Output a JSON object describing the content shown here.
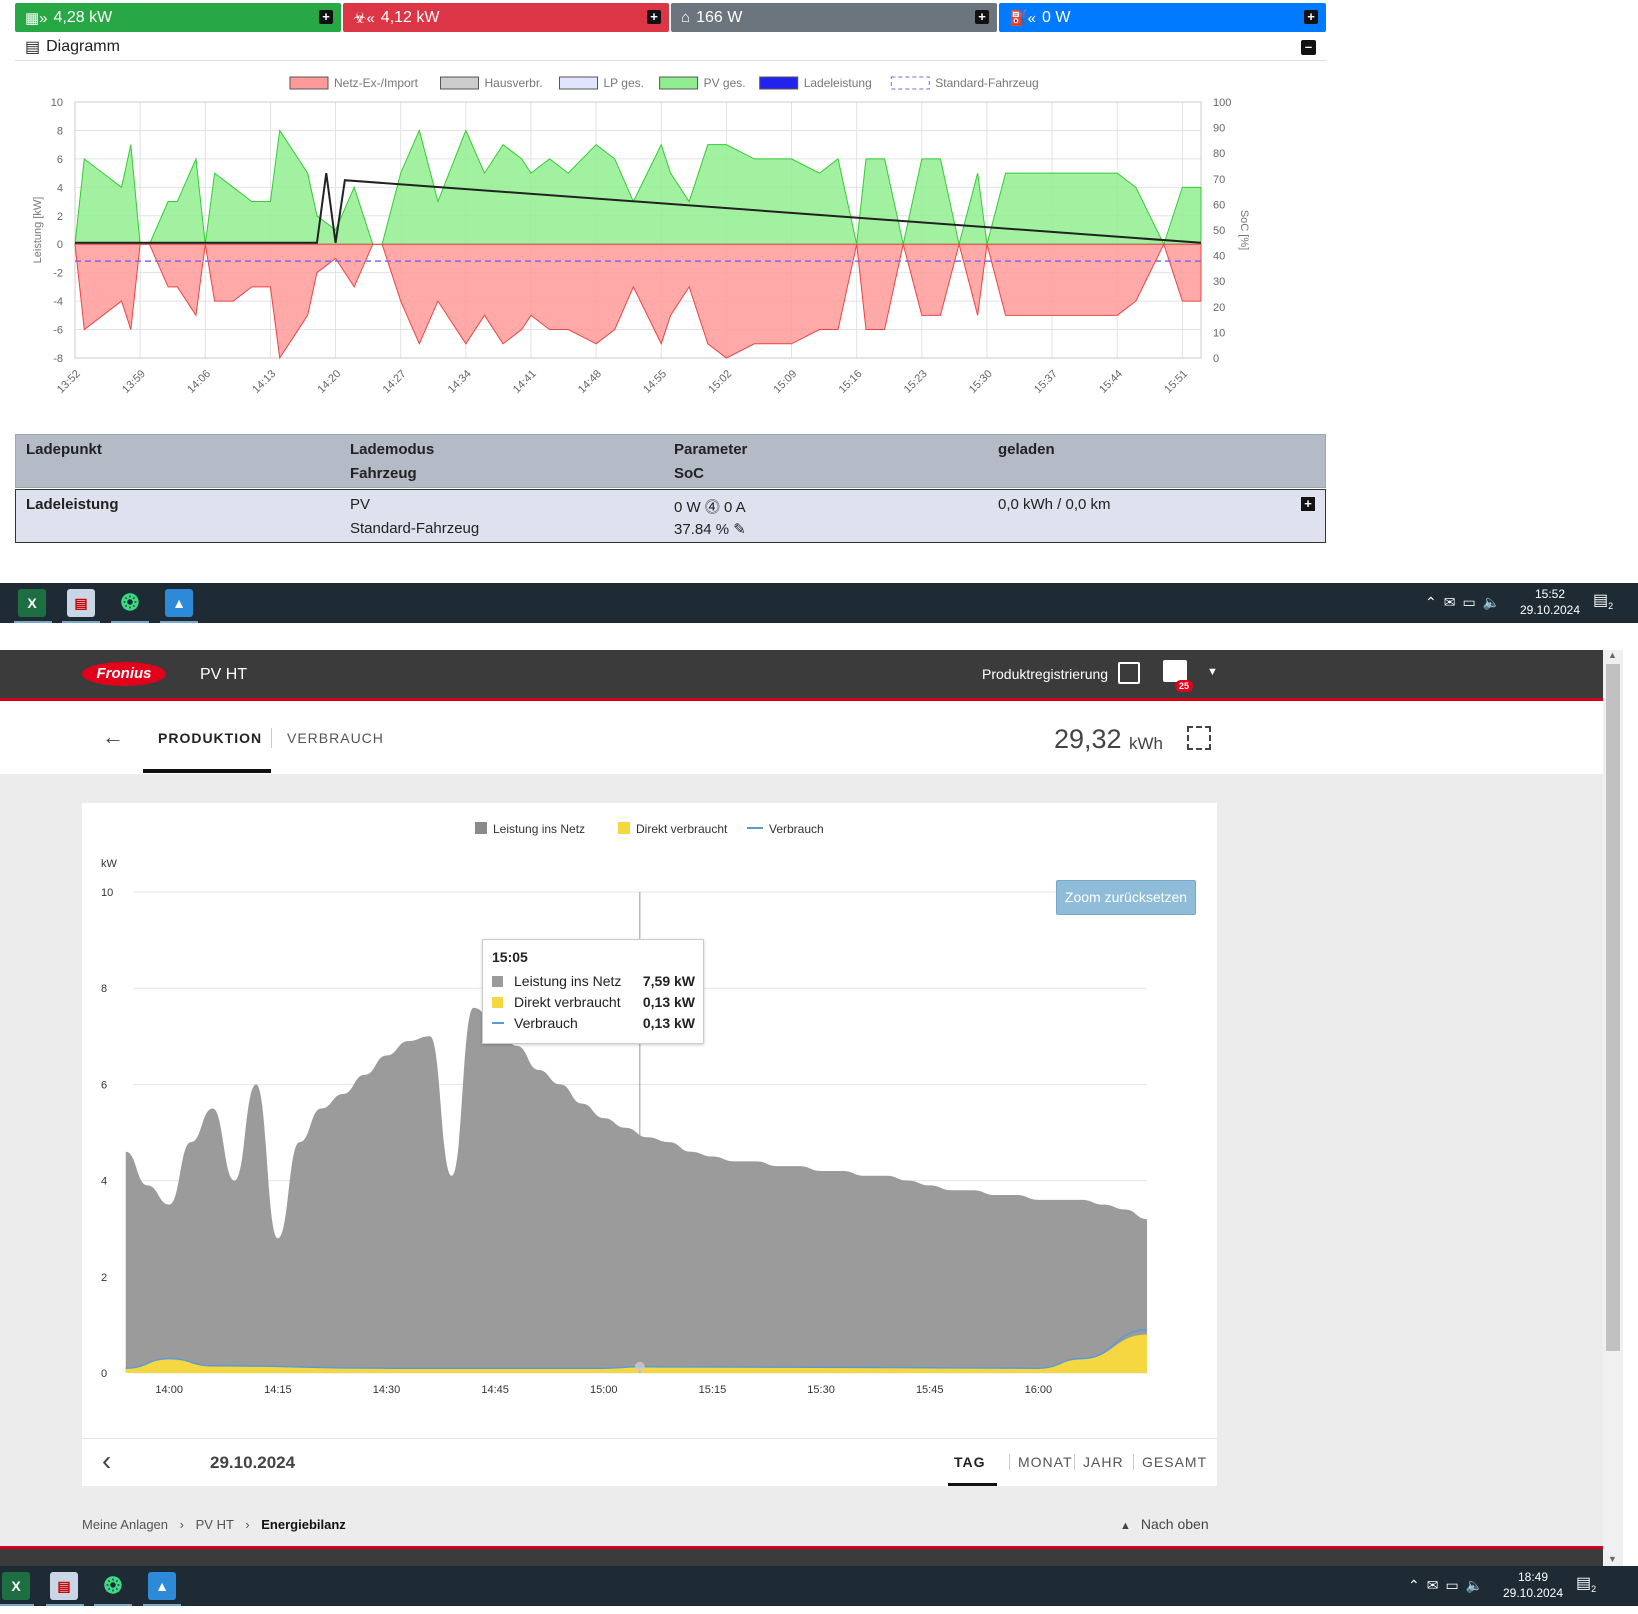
{
  "status_bar": {
    "pv": {
      "value": "4,28 kW",
      "color": "#28a745",
      "icon": "solar-panel-icon"
    },
    "grid": {
      "value": "4,12 kW",
      "color": "#dc3545",
      "icon": "power-tower-icon"
    },
    "house": {
      "value": "166 W",
      "color": "#6c757d",
      "icon": "home-icon"
    },
    "charging": {
      "value": "0 W",
      "color": "#007bff",
      "icon": "charging-station-icon"
    }
  },
  "diagram": {
    "title": "Diagramm"
  },
  "chart_data": [
    {
      "type": "area",
      "title": "",
      "legend": [
        "Netz-Ex-/Import",
        "Hausverbr.",
        "LP ges.",
        "PV ges.",
        "Ladeleistung",
        "Standard-Fahrzeug"
      ],
      "legend_placement": "top-center",
      "ylabel": "Leistung [kW]",
      "y2label": "SoC [%]",
      "ylim": [
        -8,
        10
      ],
      "y2lim": [
        0,
        100
      ],
      "yticks": [
        10,
        8,
        6,
        4,
        2,
        0,
        -2,
        -4,
        -6,
        -8
      ],
      "y2ticks": [
        100,
        90,
        80,
        70,
        60,
        50,
        40,
        30,
        20,
        10,
        0
      ],
      "xticks": [
        "13:52",
        "13:59",
        "14:06",
        "14:13",
        "14:20",
        "14:27",
        "14:34",
        "14:41",
        "14:48",
        "14:55",
        "15:02",
        "15:09",
        "15:16",
        "15:23",
        "15:30",
        "15:37",
        "15:44",
        "15:51"
      ],
      "grid": true,
      "series": [
        {
          "name": "PV ges.",
          "color": "#90ee90",
          "x": [
            "13:52",
            "13:53",
            "13:55",
            "13:57",
            "13:58",
            "13:59",
            "14:00",
            "14:02",
            "14:03",
            "14:05",
            "14:06",
            "14:07",
            "14:09",
            "14:11",
            "14:13",
            "14:14",
            "14:16",
            "14:17",
            "14:18",
            "14:20",
            "14:22",
            "14:24",
            "14:25",
            "14:27",
            "14:29",
            "14:31",
            "14:34",
            "14:36",
            "14:38",
            "14:40",
            "14:41",
            "14:43",
            "14:45",
            "14:48",
            "14:50",
            "14:52",
            "14:55",
            "14:56",
            "14:58",
            "15:00",
            "15:02",
            "15:05",
            "15:07",
            "15:09",
            "15:12",
            "15:14",
            "15:16",
            "15:17",
            "15:19",
            "15:21",
            "15:23",
            "15:25",
            "15:27",
            "15:29",
            "15:30",
            "15:32",
            "15:34",
            "15:37",
            "15:40",
            "15:44",
            "15:46",
            "15:49",
            "15:51",
            "15:53"
          ],
          "values": [
            0,
            6,
            5,
            4,
            7,
            0,
            0,
            3,
            3,
            6,
            0,
            5,
            4,
            3,
            3,
            8,
            6,
            5,
            2,
            1,
            4,
            0,
            0,
            5,
            8,
            3,
            8,
            5,
            7,
            6,
            5,
            6,
            5,
            7,
            6,
            3,
            7,
            5,
            3,
            7,
            7,
            6,
            6,
            6,
            5,
            6,
            0,
            6,
            6,
            0,
            6,
            6,
            0,
            5,
            0,
            5,
            5,
            5,
            5,
            5,
            4,
            0,
            4,
            4
          ]
        },
        {
          "name": "Netz-Ex-/Import",
          "color": "#ff9a9a",
          "x": [
            "13:52",
            "13:53",
            "13:55",
            "13:57",
            "13:58",
            "13:59",
            "14:00",
            "14:02",
            "14:03",
            "14:05",
            "14:06",
            "14:07",
            "14:09",
            "14:11",
            "14:13",
            "14:14",
            "14:16",
            "14:17",
            "14:18",
            "14:20",
            "14:22",
            "14:24",
            "14:25",
            "14:27",
            "14:29",
            "14:31",
            "14:34",
            "14:36",
            "14:38",
            "14:40",
            "14:41",
            "14:43",
            "14:45",
            "14:48",
            "14:50",
            "14:52",
            "14:55",
            "14:56",
            "14:58",
            "15:00",
            "15:02",
            "15:05",
            "15:07",
            "15:09",
            "15:12",
            "15:14",
            "15:16",
            "15:17",
            "15:19",
            "15:21",
            "15:23",
            "15:25",
            "15:27",
            "15:29",
            "15:30",
            "15:32",
            "15:34",
            "15:37",
            "15:40",
            "15:44",
            "15:46",
            "15:49",
            "15:51",
            "15:53"
          ],
          "values": [
            0,
            -6,
            -5,
            -4,
            -6,
            0,
            0,
            -3,
            -3,
            -5,
            0,
            -4,
            -4,
            -3,
            -3,
            -8,
            -6,
            -5,
            -2,
            -1,
            -3,
            0,
            0,
            -4,
            -7,
            -4,
            -7,
            -5,
            -7,
            -6,
            -5,
            -6,
            -6,
            -7,
            -6,
            -3,
            -7,
            -5,
            -3,
            -7,
            -8,
            -7,
            -7,
            -7,
            -6,
            -6,
            0,
            -6,
            -6,
            0,
            -5,
            -5,
            0,
            -5,
            0,
            -5,
            -5,
            -5,
            -5,
            -5,
            -4,
            0,
            -4,
            -4
          ]
        },
        {
          "name": "Hausverbr.",
          "color": "#222222",
          "x": [
            "13:52",
            "14:18",
            "14:19",
            "14:20",
            "14:21",
            "15:53"
          ],
          "values": [
            0.1,
            0.1,
            5,
            0.1,
            4.5,
            0.1
          ]
        },
        {
          "name": "Standard-Fahrzeug",
          "color": "#7b68ee",
          "x": [
            "13:52",
            "15:53"
          ],
          "values_soc": [
            37.84,
            37.84
          ]
        }
      ]
    },
    {
      "type": "area",
      "legend": [
        "Leistung ins Netz",
        "Direkt verbraucht",
        "Verbrauch"
      ],
      "legend_placement": "top-center",
      "ylabel": "kW",
      "ylim": [
        0,
        10
      ],
      "yticks": [
        10,
        8,
        6,
        4,
        2,
        0
      ],
      "xticks": [
        "14:00",
        "14:15",
        "14:30",
        "14:45",
        "15:00",
        "15:15",
        "15:30",
        "15:45",
        "16:00"
      ],
      "grid": true,
      "series": [
        {
          "name": "Leistung ins Netz",
          "color": "#9b9b9b",
          "x": [
            13.9,
            13.95,
            14.0,
            14.05,
            14.1,
            14.15,
            14.2,
            14.25,
            14.3,
            14.35,
            14.4,
            14.45,
            14.5,
            14.55,
            14.6,
            14.65,
            14.7,
            14.75,
            14.8,
            14.85,
            14.9,
            14.95,
            15.0,
            15.05,
            15.1,
            15.15,
            15.2,
            15.25,
            15.3,
            15.35,
            15.4,
            15.45,
            15.5,
            15.55,
            15.6,
            15.65,
            15.7,
            15.75,
            15.8,
            15.85,
            15.9,
            15.95,
            16.0,
            16.05,
            16.1,
            16.15,
            16.2,
            16.25
          ],
          "values": [
            4.6,
            3.9,
            3.5,
            4.8,
            5.5,
            4.0,
            6.0,
            2.8,
            4.8,
            5.5,
            5.8,
            6.2,
            6.6,
            6.9,
            7.0,
            4.1,
            7.59,
            7.3,
            6.8,
            6.3,
            6.0,
            5.6,
            5.3,
            5.1,
            4.9,
            4.8,
            4.6,
            4.5,
            4.4,
            4.4,
            4.3,
            4.3,
            4.2,
            4.2,
            4.1,
            4.1,
            4.0,
            3.9,
            3.8,
            3.8,
            3.7,
            3.7,
            3.6,
            3.6,
            3.6,
            3.5,
            3.4,
            3.2
          ]
        },
        {
          "name": "Direkt verbraucht",
          "color": "#f5d742",
          "x": [
            13.9,
            14.0,
            14.1,
            14.5,
            15.0,
            15.08,
            15.5,
            16.0,
            16.1,
            16.25
          ],
          "values": [
            0.1,
            0.3,
            0.15,
            0.1,
            0.1,
            0.13,
            0.12,
            0.1,
            0.3,
            0.8
          ]
        },
        {
          "name": "Verbrauch",
          "color": "#5b9bd5",
          "x": [
            13.9,
            14.0,
            14.1,
            14.5,
            15.0,
            15.08,
            15.5,
            16.0,
            16.1,
            16.25
          ],
          "values": [
            0.1,
            0.3,
            0.15,
            0.1,
            0.1,
            0.13,
            0.12,
            0.1,
            0.3,
            0.9
          ]
        }
      ]
    }
  ],
  "lp_table": {
    "h_ladepunkt": "Ladepunkt",
    "h_lademodus": "Lademodus",
    "h_fahrzeug": "Fahrzeug",
    "h_parameter": "Parameter",
    "h_soc": "SoC",
    "h_geladen": "geladen",
    "row_name": "Ladeleistung",
    "row_mode": "PV",
    "row_vehicle": "Standard-Fahrzeug",
    "row_param": "0 W ⓸ 0 A",
    "row_soc": "37.84 %",
    "row_geladen": "0,0 kWh / 0,0 km"
  },
  "taskbar1": {
    "time": "15:52",
    "date": "29.10.2024",
    "notif": "2"
  },
  "taskbar2": {
    "time": "18:49",
    "date": "29.10.2024",
    "notif": "2"
  },
  "fronius": {
    "logo": "Fronius",
    "plant": "PV HT",
    "produktregistrierung": "Produktregistrierung",
    "badge": "25",
    "tab_produktion": "PRODUKTION",
    "tab_verbrauch": "VERBRAUCH",
    "total_value": "29,32",
    "total_unit": "kWh",
    "legend_netz": "Leistung ins Netz",
    "legend_direkt": "Direkt verbraucht",
    "legend_verbrauch": "Verbrauch",
    "y_unit": "kW",
    "zoom_reset": "Zoom zurücksetzen",
    "tooltip_time": "15:05",
    "tooltip_netz_label": "Leistung ins Netz",
    "tooltip_netz_value": "7,59 kW",
    "tooltip_direkt_label": "Direkt verbraucht",
    "tooltip_direkt_value": "0,13 kW",
    "tooltip_verbrauch_label": "Verbrauch",
    "tooltip_verbrauch_value": "0,13 kW",
    "date": "29.10.2024",
    "period_tag": "TAG",
    "period_monat": "MONAT",
    "period_jahr": "JAHR",
    "period_gesamt": "GESAMT",
    "bc_1": "Meine Anlagen",
    "bc_2": "PV HT",
    "bc_3": "Energiebilanz",
    "nach_oben": "Nach oben"
  }
}
